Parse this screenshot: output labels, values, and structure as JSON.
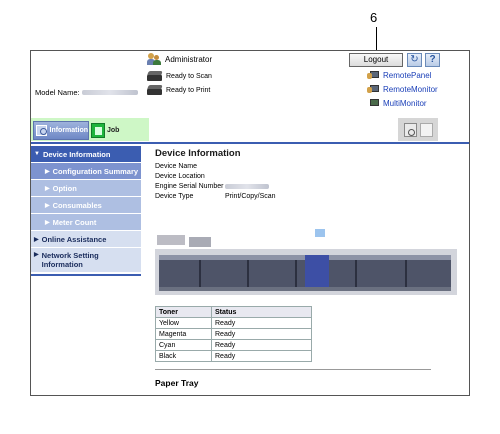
{
  "callout": {
    "number": "6"
  },
  "header": {
    "user_label": "Administrator",
    "logout_label": "Logout",
    "status": [
      {
        "text": "Ready to Scan",
        "icon": "scanner-icon"
      },
      {
        "text": "Ready to Print",
        "icon": "printer-icon"
      }
    ],
    "model_label": "Model Name:",
    "remote": [
      {
        "label": "RemotePanel",
        "icon": "remote-panel-icon"
      },
      {
        "label": "RemoteMonitor",
        "icon": "remote-monitor-icon"
      },
      {
        "label": "MultiMonitor",
        "icon": "multi-monitor-icon"
      }
    ]
  },
  "tabs": {
    "information": "Information",
    "job": "Job"
  },
  "sidebar": {
    "items": [
      {
        "label": "Device Information",
        "level": 1,
        "active": true,
        "expanded": true
      },
      {
        "label": "Configuration Summary",
        "level": 2,
        "active": true
      },
      {
        "label": "Option",
        "level": 2
      },
      {
        "label": "Consumables",
        "level": 2
      },
      {
        "label": "Meter Count",
        "level": 2
      },
      {
        "label": "Online Assistance",
        "level": 1
      },
      {
        "label": "Network Setting Information",
        "level": 1
      }
    ]
  },
  "main": {
    "title": "Device Information",
    "fields": [
      {
        "key": "Device Name",
        "value": ""
      },
      {
        "key": "Device Location",
        "value": ""
      },
      {
        "key": "Engine Serial Number",
        "value": ""
      },
      {
        "key": "Device Type",
        "value": "Print/Copy/Scan"
      }
    ],
    "toner_table": {
      "headers": [
        "Toner",
        "Status"
      ],
      "rows": [
        [
          "Yellow",
          "Ready"
        ],
        [
          "Magenta",
          "Ready"
        ],
        [
          "Cyan",
          "Ready"
        ],
        [
          "Black",
          "Ready"
        ]
      ]
    },
    "paper_tray_title": "Paper Tray"
  },
  "colors": {
    "accent": "#3b5db1",
    "tab_band": "#cef7c6",
    "link": "#1a3fb8"
  }
}
